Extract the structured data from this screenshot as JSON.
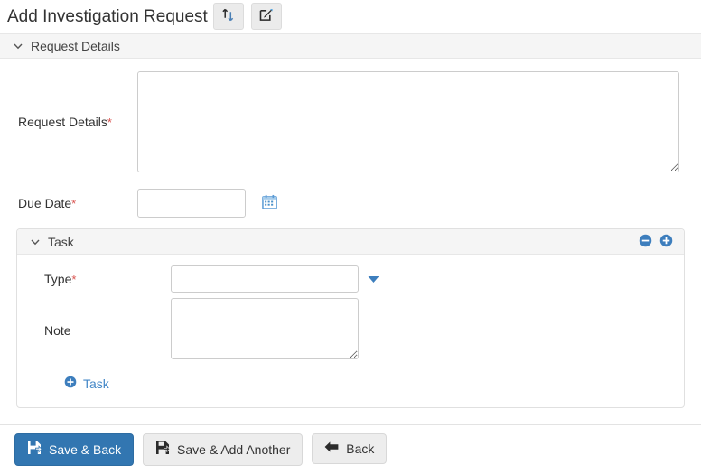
{
  "header": {
    "title": "Add Investigation Request",
    "buttons": [
      {
        "name": "exchange-button",
        "icon": "exchange-icon",
        "label": ""
      },
      {
        "name": "edit-button",
        "icon": "edit-square-icon",
        "label": ""
      }
    ]
  },
  "sections": {
    "request_details": {
      "heading": "Request Details",
      "chevron": "chevron-down-icon",
      "fields": {
        "request_details": {
          "label": "Request Details",
          "required_marker": "*",
          "value": "",
          "placeholder": ""
        },
        "due_date": {
          "label": "Due Date",
          "required_marker": "*",
          "value": "",
          "placeholder": "",
          "calendar_icon": "calendar-icon"
        }
      }
    },
    "task": {
      "heading": "Task",
      "chevron": "chevron-down-icon",
      "remove_icon": "minus-circle-icon",
      "add_icon": "plus-circle-icon",
      "fields": {
        "type": {
          "label": "Type",
          "required_marker": "*",
          "value": "",
          "placeholder": "",
          "caret_icon": "caret-down-icon",
          "options": []
        },
        "note": {
          "label": "Note",
          "required_marker": "",
          "value": "",
          "placeholder": ""
        }
      },
      "add_link": {
        "label": "Task",
        "icon": "plus-circle-icon"
      }
    }
  },
  "footer": {
    "buttons": [
      {
        "name": "save-and-back-button",
        "label": "Save & Back",
        "icon": "save-icon",
        "style": "primary"
      },
      {
        "name": "save-and-add-another-button",
        "label": "Save & Add Another",
        "icon": "save-icon",
        "style": "default"
      },
      {
        "name": "back-button",
        "label": "Back",
        "icon": "arrow-left-icon",
        "style": "default"
      }
    ]
  },
  "colors": {
    "primary": "#3276b1",
    "link": "#4387c7",
    "required": "#d9534f",
    "panel_heading_bg": "#f5f5f5",
    "border": "#e0e0e0"
  }
}
